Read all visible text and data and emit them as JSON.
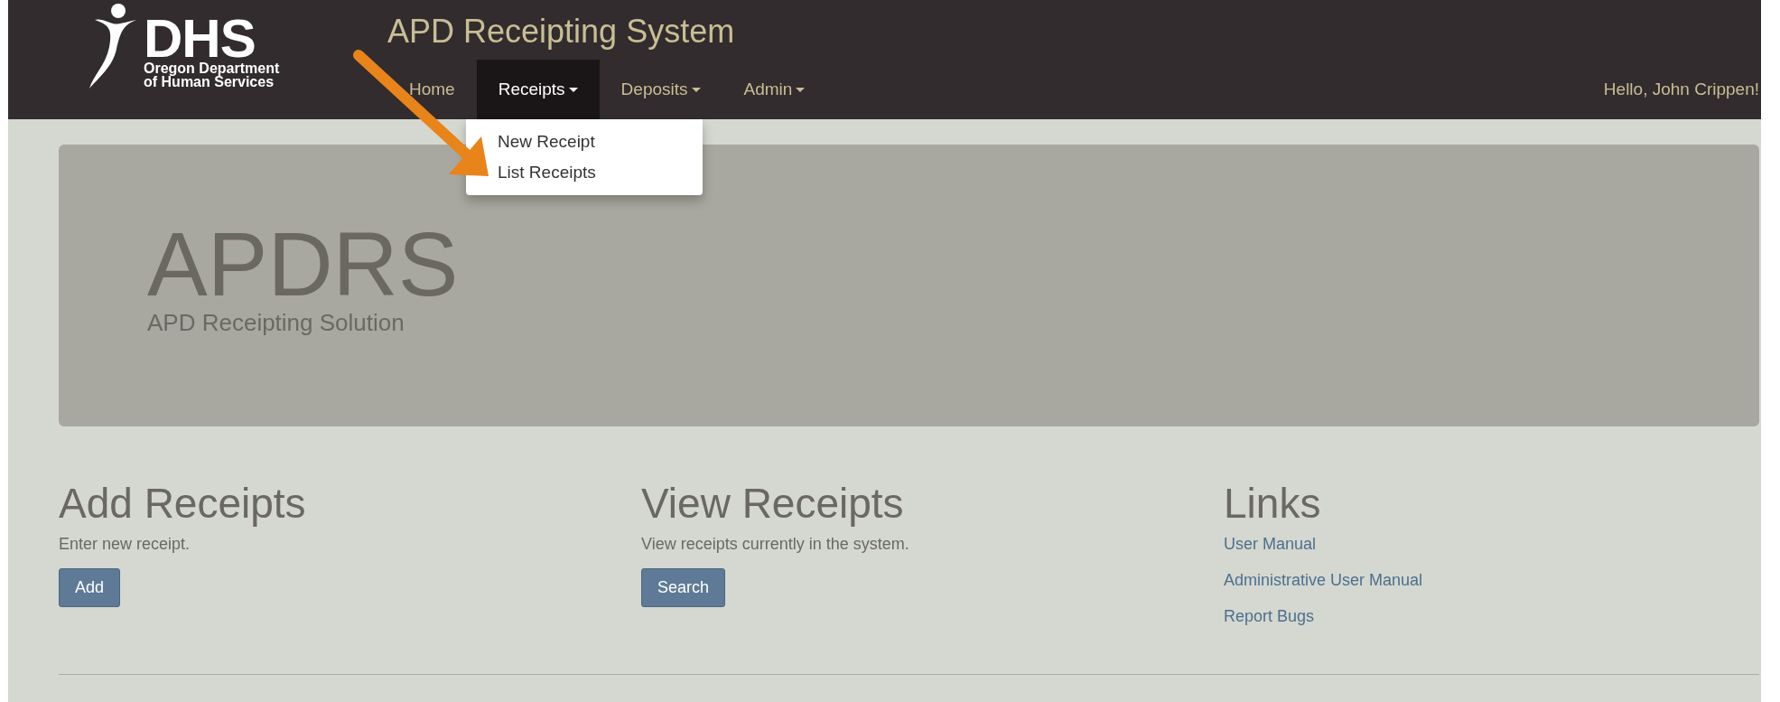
{
  "brand": {
    "logo_text": "DHS",
    "org_lines": [
      "Oregon Department",
      "of Human Services"
    ]
  },
  "app_title": "APD Receipting System",
  "nav": [
    {
      "label": "Home",
      "selected": false,
      "dropdown": false
    },
    {
      "label": "Receipts",
      "selected": true,
      "dropdown": true
    },
    {
      "label": "Deposits",
      "selected": false,
      "dropdown": true
    },
    {
      "label": "Admin",
      "selected": false,
      "dropdown": true
    }
  ],
  "user_greeting": "Hello, John Crippen!",
  "dropdown_menu": [
    "New Receipt",
    "List Receipts"
  ],
  "jumbotron": {
    "title": "APDRS",
    "subtitle": "APD Receipting Solution"
  },
  "sections": [
    {
      "kind": "button",
      "heading": "Add Receipts",
      "text": "Enter new receipt.",
      "button": "Add"
    },
    {
      "kind": "button",
      "heading": "View Receipts",
      "text": "View receipts currently in the system.",
      "button": "Search"
    },
    {
      "kind": "links",
      "heading": "Links",
      "links": [
        "User Manual",
        "Administrative User Manual",
        "Report Bugs"
      ]
    }
  ]
}
